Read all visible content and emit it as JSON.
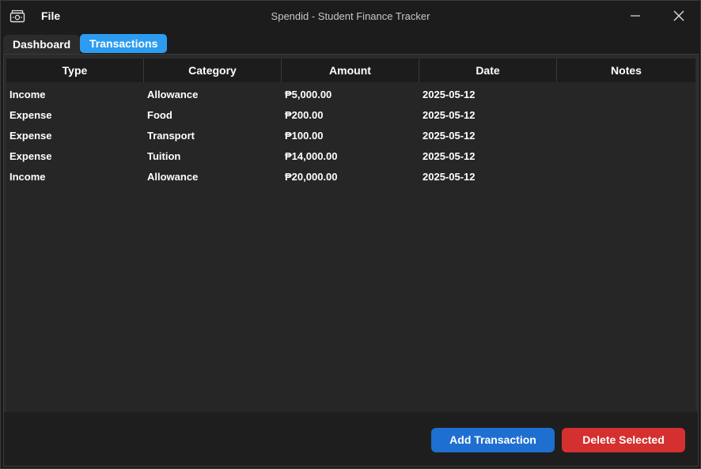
{
  "menu": {
    "file": "File"
  },
  "window": {
    "title": "Spendid - Student Finance Tracker"
  },
  "tabs": [
    {
      "label": "Dashboard",
      "active": false
    },
    {
      "label": "Transactions",
      "active": true
    }
  ],
  "table": {
    "columns": [
      "Type",
      "Category",
      "Amount",
      "Date",
      "Notes"
    ],
    "rows": [
      [
        "Income",
        "Allowance",
        "₱5,000.00",
        "2025-05-12",
        ""
      ],
      [
        "Expense",
        "Food",
        "₱200.00",
        "2025-05-12",
        ""
      ],
      [
        "Expense",
        "Transport",
        "₱100.00",
        "2025-05-12",
        ""
      ],
      [
        "Expense",
        "Tuition",
        "₱14,000.00",
        "2025-05-12",
        ""
      ],
      [
        "Income",
        "Allowance",
        "₱20,000.00",
        "2025-05-12",
        ""
      ]
    ]
  },
  "actions": {
    "add_label": "Add Transaction",
    "delete_label": "Delete Selected"
  },
  "colors": {
    "accent": "#2d9cf0",
    "add_button": "#1f6fd1",
    "delete_button": "#d43030",
    "background": "#1c1c1c"
  },
  "icons": {
    "app": "money-bill-icon",
    "minimize": "minimize-icon",
    "close": "close-icon"
  }
}
